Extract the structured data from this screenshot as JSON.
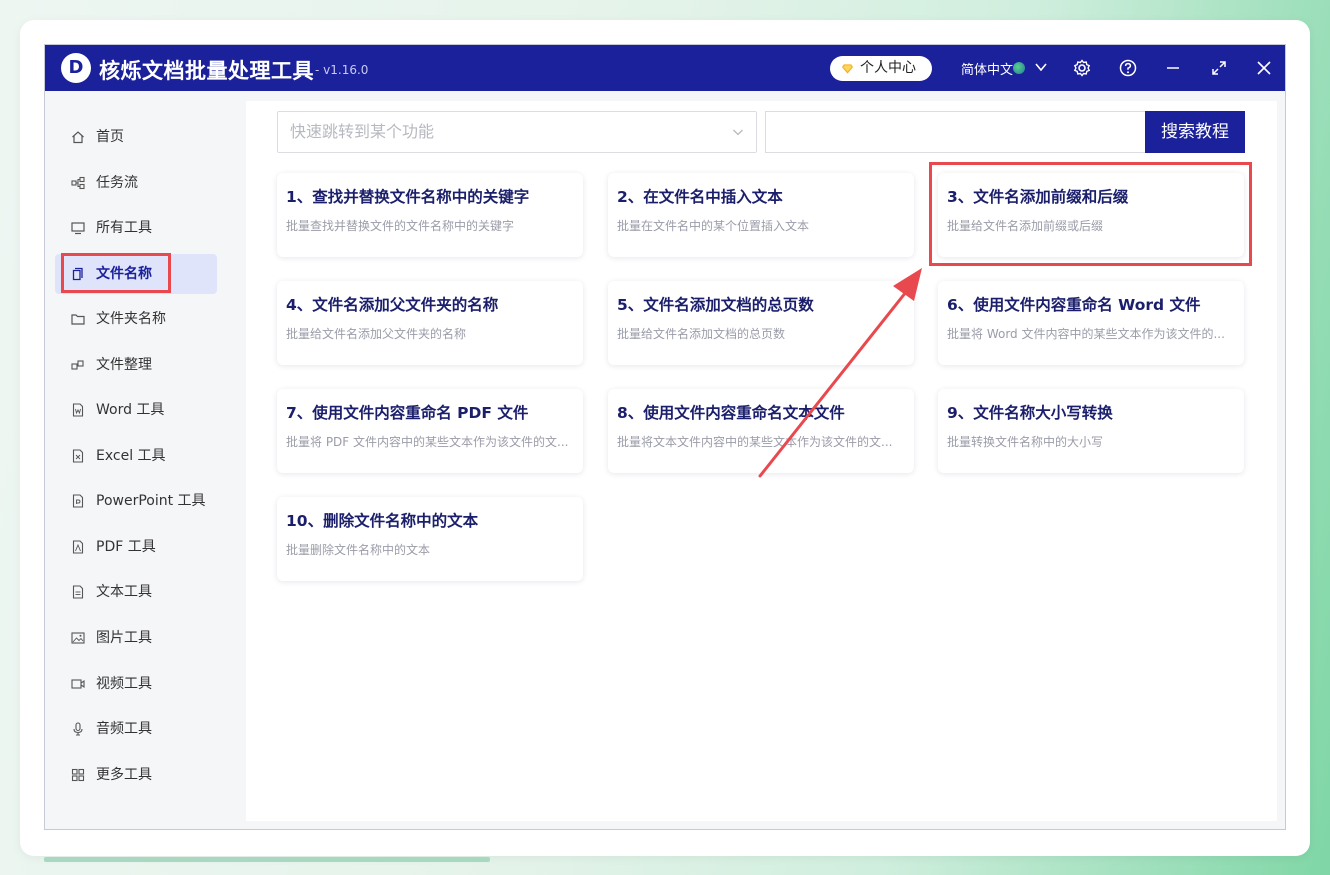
{
  "app": {
    "title": "核烁文档批量处理工具",
    "version": "- v1.16.0",
    "logo_letter": "D"
  },
  "titlebar": {
    "user_center": "个人中心",
    "language": "简体中文",
    "icons": [
      "settings-icon",
      "help-icon",
      "minimize-icon",
      "maximize-icon",
      "close-icon"
    ]
  },
  "sidebar": {
    "items": [
      {
        "label": "首页",
        "icon": "home-icon"
      },
      {
        "label": "任务流",
        "icon": "workflow-icon"
      },
      {
        "label": "所有工具",
        "icon": "monitor-icon"
      },
      {
        "label": "文件名称",
        "icon": "file-name-icon",
        "active": true
      },
      {
        "label": "文件夹名称",
        "icon": "folder-icon"
      },
      {
        "label": "文件整理",
        "icon": "organize-icon"
      },
      {
        "label": "Word 工具",
        "icon": "word-icon"
      },
      {
        "label": "Excel 工具",
        "icon": "excel-icon"
      },
      {
        "label": "PowerPoint 工具",
        "icon": "powerpoint-icon"
      },
      {
        "label": "PDF 工具",
        "icon": "pdf-icon"
      },
      {
        "label": "文本工具",
        "icon": "text-icon"
      },
      {
        "label": "图片工具",
        "icon": "image-icon"
      },
      {
        "label": "视频工具",
        "icon": "video-icon"
      },
      {
        "label": "音频工具",
        "icon": "microphone-icon"
      },
      {
        "label": "更多工具",
        "icon": "grid-icon"
      }
    ]
  },
  "search": {
    "jump_placeholder": "快速跳转到某个功能",
    "query": "",
    "button_label": "搜索教程"
  },
  "tools": [
    {
      "title": "1、查找并替换文件名称中的关键字",
      "desc": "批量查找并替换文件的文件名称中的关键字"
    },
    {
      "title": "2、在文件名中插入文本",
      "desc": "批量在文件名中的某个位置插入文本"
    },
    {
      "title": "3、文件名添加前缀和后缀",
      "desc": "批量给文件名添加前缀或后缀"
    },
    {
      "title": "4、文件名添加父文件夹的名称",
      "desc": "批量给文件名添加父文件夹的名称"
    },
    {
      "title": "5、文件名添加文档的总页数",
      "desc": "批量给文件名添加文档的总页数"
    },
    {
      "title": "6、使用文件内容重命名 Word 文件",
      "desc": "批量将 Word 文件内容中的某些文本作为该文件的..."
    },
    {
      "title": "7、使用文件内容重命名 PDF 文件",
      "desc": "批量将 PDF 文件内容中的某些文本作为该文件的文..."
    },
    {
      "title": "8、使用文件内容重命名文本文件",
      "desc": "批量将文本文件内容中的某些文本作为该文件的文..."
    },
    {
      "title": "9、文件名称大小写转换",
      "desc": "批量转换文件名称中的大小写"
    },
    {
      "title": "10、删除文件名称中的文本",
      "desc": "批量删除文件名称中的文本"
    }
  ],
  "colors": {
    "brand": "#1b209b",
    "highlight": "#e8494f",
    "active_bg": "#dfe4fb"
  }
}
